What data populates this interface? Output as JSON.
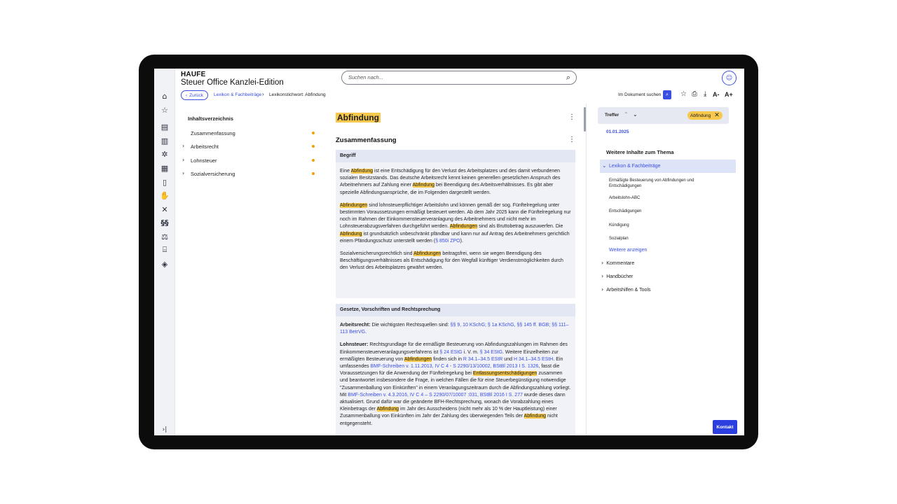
{
  "header": {
    "brand": "HAUFE",
    "product": "Steuer Office Kanzlei-Edition",
    "search_placeholder": "Suchen nach..."
  },
  "breadcrumb": {
    "back_label": "Zurück",
    "parent": "Lexikon & Fachbeiträge",
    "current": "Lexikonstichwort: Abfindung"
  },
  "toolbar": {
    "doc_search_label": "Im Dokument suchen",
    "font_smaller": "A-",
    "font_larger": "A+"
  },
  "toc": {
    "title": "Inhaltsverzeichnis",
    "items": [
      {
        "label": "Zusammenfassung",
        "expandable": false
      },
      {
        "label": "Arbeitsrecht",
        "expandable": true
      },
      {
        "label": "Lohnsteuer",
        "expandable": true
      },
      {
        "label": "Sozialversicherung",
        "expandable": true
      }
    ]
  },
  "document": {
    "title": "Abfindung",
    "section_title": "Zusammenfassung",
    "card1": {
      "heading": "Begriff",
      "p1": {
        "a": "Eine ",
        "hl1": "Abfindung",
        "b": " ist eine Entschädigung für den Verlust des Arbeitsplatzes und des damit verbundenen sozialen Besitzstands. Das deutsche Arbeitsrecht kennt keinen generellen gesetzlichen Anspruch des Arbeitnehmers auf Zahlung einer ",
        "hl2": "Abfindung",
        "c": " bei Beendigung des Arbeitsverhältnisses. Es gibt aber spezielle Abfindungsansprüche, die im Folgenden dargestellt werden."
      },
      "p2": {
        "hl1": "Abfindungen",
        "a": " sind lohnsteuerpflichtiger Arbeitslohn und können gemäß der sog. Fünftelregelung unter bestimmten Voraussetzungen ermäßigt besteuert werden. Ab dem Jahr 2025 kann die Fünftelregelung nur noch im Rahmen der Einkommensteuerveranlagung des Arbeitnehmers und nicht mehr im Lohnsteuerabzugsverfahren durchgeführt werden. ",
        "hl2": "Abfindungen",
        "b": " sind als Bruttobetrag auszuwerfen. Die ",
        "hl3": "Abfindung",
        "c": " ist grundsätzlich unbeschränkt pfändbar und kann nur auf Antrag des Arbeitnehmers gerichtlich einem Pfändungsschutz unterstellt werden (",
        "link": "§ 850i ZPO",
        "d": ")."
      },
      "p3": {
        "a": "Sozialversicherungsrechtlich sind ",
        "hl1": "Abfindungen",
        "b": " beitragsfrei, wenn sie wegen Beendigung des Beschäftigungsverhältnisses als Entschädigung für den Wegfall künftiger Verdienstmöglichkeiten durch den Verlust des Arbeitsplatzes gewährt werden."
      }
    },
    "card2": {
      "heading": "Gesetze, Vorschriften und Rechtsprechung",
      "p1": {
        "label": "Arbeitsrecht:",
        "a": " Die wichtigsten Rechtsquellen sind: ",
        "link": "§§ 9, 10 KSchG; § 1a KSchG, §§ 145 ff. BGB; §§ 111–113 BetrVG",
        "b": "."
      },
      "p2": {
        "label": "Lohnsteuer:",
        "a": " Rechtsgrundlage für die ermäßigte Besteuerung von Abfindungszahlungen im Rahmen des Einkommensteuerveranlagungsverfahrens ist ",
        "link1": "§ 24 EStG",
        "b": " i. V. m. ",
        "link2": "§ 34 EStG",
        "c": ". Weitere Einzelheiten zur ermäßigten Besteuerung von ",
        "hl1": "Abfindungen",
        "d": " finden sich in ",
        "link3": "R 34.1–34.5 EStR",
        "e": " und ",
        "link4": "H 34.1–34.5 EStH",
        "f": ". Ein umfassendes ",
        "link5": "BMF-Schreiben v. 1.11.2013, IV C 4 - S 2290/13/10002, BStBl 2013 I S. 1326",
        "g": ", fasst die Voraussetzungen für die Anwendung der Fünftelregelung bei ",
        "hl2": "Entlassungsentschädigungen",
        "h": " zusammen und beantwortet insbesondere die Frage, in welchen Fällen die für eine Steuerbegünstigung notwendige \"Zusammenballung von Einkünften\" in einem Veranlagungszeitraum durch die Abfindungszahlung vorliegt. Mit ",
        "link6": "BMF-Schreiben v. 4.3.2016, IV C 4 – S 2290/07/10007 :031, BStBl 2016 I S. 277",
        "i": " wurde dieses dann aktualisiert. Grund dafür war die geänderte BFH-Rechtsprechung, wonach die Vorabzahlung eines Kleinbetrags der ",
        "hl3": "Abfindung",
        "j": " im Jahr des Ausscheidens (nicht mehr als 10 % der Hauptleistung) einer Zusammenballung von Einkünften im Jahr der Zahlung des überwiegenden Teils der ",
        "hl4": "Abfindung",
        "k": " nicht entgegensteht."
      }
    }
  },
  "right_panel": {
    "hits_label": "Treffer",
    "hits_chip": "Abfindung",
    "date": "01.01.2025",
    "more_title": "Weitere Inhalte zum Thema",
    "open_section": "Lexikon & Fachbeiträge",
    "sub_items": [
      "Ermäßigte Besteuerung von Abfindungen und Entschädigungen",
      "Arbeitslohn-ABC",
      "Entschädigungen",
      "Kündigung",
      "Sozialplan"
    ],
    "show_more": "Weitere anzeigen",
    "sections": [
      "Kommentare",
      "Handbücher",
      "Arbeitshilfen & Tools"
    ]
  },
  "contact_label": "Kontakt",
  "rail_icons": [
    "home-icon",
    "star-icon",
    "document-check-icon",
    "book-icon",
    "network-icon",
    "newspaper-icon",
    "book-open-icon",
    "hand-money-icon",
    "tools-icon",
    "paragraph-icon",
    "scales-icon",
    "bank-icon",
    "graduation-cap-icon",
    "expand-panel-icon"
  ],
  "colors": {
    "accent": "#3a4fe0",
    "highlight": "#f6c84c",
    "dot": "#f0a000"
  }
}
